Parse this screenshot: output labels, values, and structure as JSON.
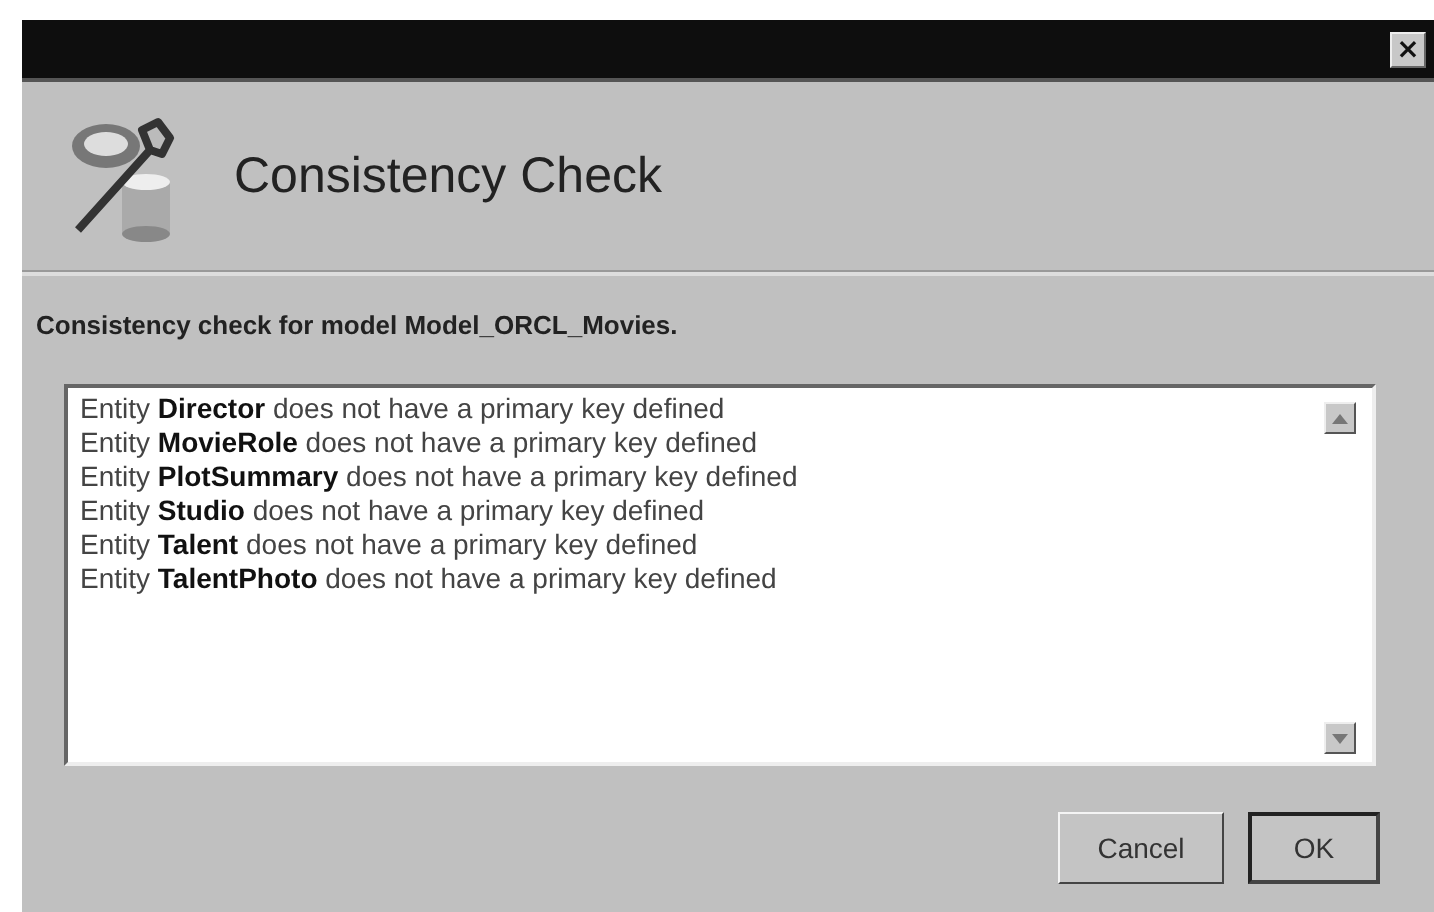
{
  "window": {
    "close_glyph": "×"
  },
  "header": {
    "title": "Consistency Check"
  },
  "subtitle": "Consistency check for model Model_ORCL_Movies.",
  "messages": [
    "Entity **Director** does not have a primary key defined",
    "Entity **MovieRole** does not have a primary key defined",
    "Entity **PlotSummary** does not have a primary key defined",
    "Entity **Studio** does not have a primary key defined",
    "Entity **Talent** does not have a primary key defined",
    "Entity **TalentPhoto** does not have a primary key defined"
  ],
  "buttons": [
    {
      "label": "Cancel",
      "default": false
    },
    {
      "label": "OK",
      "default": true
    }
  ]
}
